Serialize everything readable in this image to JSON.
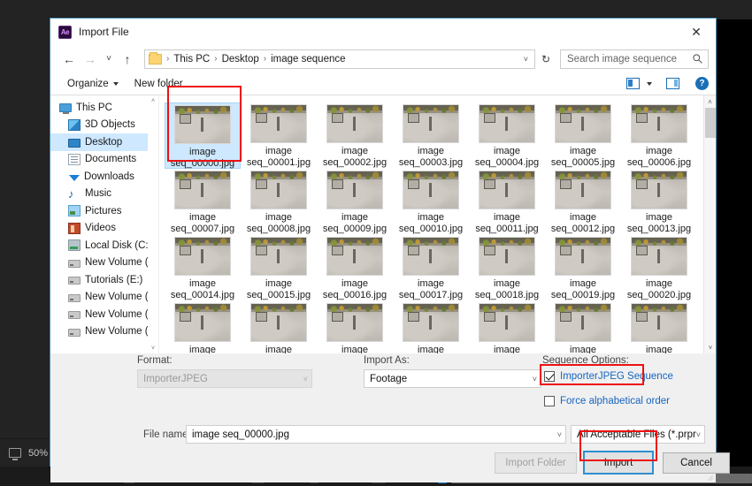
{
  "host_app": {
    "zoom_level": "50%",
    "monitor_icon": "monitor-icon"
  },
  "dialog": {
    "title": "Import File",
    "app_icon": "after-effects-icon",
    "app_icon_label": "Ae",
    "close_label": "✕"
  },
  "nav": {
    "back": "←",
    "forward": "→",
    "recent": "˅",
    "up": "↑",
    "refresh": "↻",
    "address_chevron": "˅",
    "breadcrumbs": [
      "This PC",
      "Desktop",
      "image sequence"
    ],
    "separator": "›"
  },
  "search": {
    "placeholder": "Search image sequence",
    "value": ""
  },
  "toolbar": {
    "organize_label": "Organize",
    "new_folder_label": "New folder",
    "view_icon": "view-options-icon",
    "view_caret": "view-dropdown-caret",
    "pane_icon": "preview-pane-icon",
    "help_icon": "help-icon",
    "help_glyph": "?"
  },
  "sidebar": {
    "items": [
      {
        "label": "This PC",
        "icon": "this-pc-icon",
        "indent": false,
        "selected": false
      },
      {
        "label": "3D Objects",
        "icon": "3d-objects-icon",
        "indent": true,
        "selected": false
      },
      {
        "label": "Desktop",
        "icon": "desktop-icon",
        "indent": true,
        "selected": true
      },
      {
        "label": "Documents",
        "icon": "documents-icon",
        "indent": true,
        "selected": false
      },
      {
        "label": "Downloads",
        "icon": "downloads-icon",
        "indent": true,
        "selected": false
      },
      {
        "label": "Music",
        "icon": "music-icon",
        "indent": true,
        "selected": false
      },
      {
        "label": "Pictures",
        "icon": "pictures-icon",
        "indent": true,
        "selected": false
      },
      {
        "label": "Videos",
        "icon": "videos-icon",
        "indent": true,
        "selected": false
      },
      {
        "label": "Local Disk (C:)",
        "icon": "local-disk-icon",
        "indent": true,
        "selected": false
      },
      {
        "label": "New Volume (D:",
        "icon": "drive-icon",
        "indent": true,
        "selected": false
      },
      {
        "label": "Tutorials (E:)",
        "icon": "drive-icon",
        "indent": true,
        "selected": false
      },
      {
        "label": "New Volume (F:)",
        "icon": "drive-icon",
        "indent": true,
        "selected": false
      },
      {
        "label": "New Volume (G:",
        "icon": "drive-icon",
        "indent": true,
        "selected": false
      },
      {
        "label": "New Volume (I:)",
        "icon": "drive-icon",
        "indent": true,
        "selected": false
      }
    ],
    "scroll_up": "˄",
    "scroll_down": "˅"
  },
  "files": {
    "scroll_up": "˄",
    "scroll_down": "˅",
    "items": [
      {
        "line1": "image",
        "line2": "seq_00000.jpg",
        "selected": true
      },
      {
        "line1": "image",
        "line2": "seq_00001.jpg",
        "selected": false
      },
      {
        "line1": "image",
        "line2": "seq_00002.jpg",
        "selected": false
      },
      {
        "line1": "image",
        "line2": "seq_00003.jpg",
        "selected": false
      },
      {
        "line1": "image",
        "line2": "seq_00004.jpg",
        "selected": false
      },
      {
        "line1": "image",
        "line2": "seq_00005.jpg",
        "selected": false
      },
      {
        "line1": "image",
        "line2": "seq_00006.jpg",
        "selected": false
      },
      {
        "line1": "image",
        "line2": "seq_00007.jpg",
        "selected": false
      },
      {
        "line1": "image",
        "line2": "seq_00008.jpg",
        "selected": false
      },
      {
        "line1": "image",
        "line2": "seq_00009.jpg",
        "selected": false
      },
      {
        "line1": "image",
        "line2": "seq_00010.jpg",
        "selected": false
      },
      {
        "line1": "image",
        "line2": "seq_00011.jpg",
        "selected": false
      },
      {
        "line1": "image",
        "line2": "seq_00012.jpg",
        "selected": false
      },
      {
        "line1": "image",
        "line2": "seq_00013.jpg",
        "selected": false
      },
      {
        "line1": "image",
        "line2": "seq_00014.jpg",
        "selected": false
      },
      {
        "line1": "image",
        "line2": "seq_00015.jpg",
        "selected": false
      },
      {
        "line1": "image",
        "line2": "seq_00016.jpg",
        "selected": false
      },
      {
        "line1": "image",
        "line2": "seq_00017.jpg",
        "selected": false
      },
      {
        "line1": "image",
        "line2": "seq_00018.jpg",
        "selected": false
      },
      {
        "line1": "image",
        "line2": "seq_00019.jpg",
        "selected": false
      },
      {
        "line1": "image",
        "line2": "seq_00020.jpg",
        "selected": false
      },
      {
        "line1": "image",
        "line2": "",
        "selected": false
      },
      {
        "line1": "image",
        "line2": "",
        "selected": false
      },
      {
        "line1": "image",
        "line2": "",
        "selected": false
      },
      {
        "line1": "image",
        "line2": "",
        "selected": false
      },
      {
        "line1": "image",
        "line2": "",
        "selected": false
      },
      {
        "line1": "image",
        "line2": "",
        "selected": false
      },
      {
        "line1": "image",
        "line2": "",
        "selected": false
      }
    ]
  },
  "options": {
    "format_label": "Format:",
    "format_value": "ImporterJPEG",
    "import_as_label": "Import As:",
    "import_as_value": "Footage",
    "sequence_options_label": "Sequence Options:",
    "sequence_checkbox_label": "ImporterJPEG Sequence",
    "sequence_checkbox_checked": true,
    "force_alpha_label": "Force alphabetical order",
    "force_alpha_checked": false,
    "chevron": "˅"
  },
  "footer": {
    "filename_label": "File name:",
    "filename_value": "image seq_00000.jpg",
    "filetype_value": "All Acceptable Files (*.prproj;*.c",
    "import_folder_label": "Import Folder",
    "import_label": "Import",
    "cancel_label": "Cancel",
    "chevron": "˅"
  },
  "colors": {
    "accent": "#2f8fd0",
    "annotation": "#ee1111",
    "link_blue": "#1565c0",
    "selection": "#cde8ff"
  }
}
